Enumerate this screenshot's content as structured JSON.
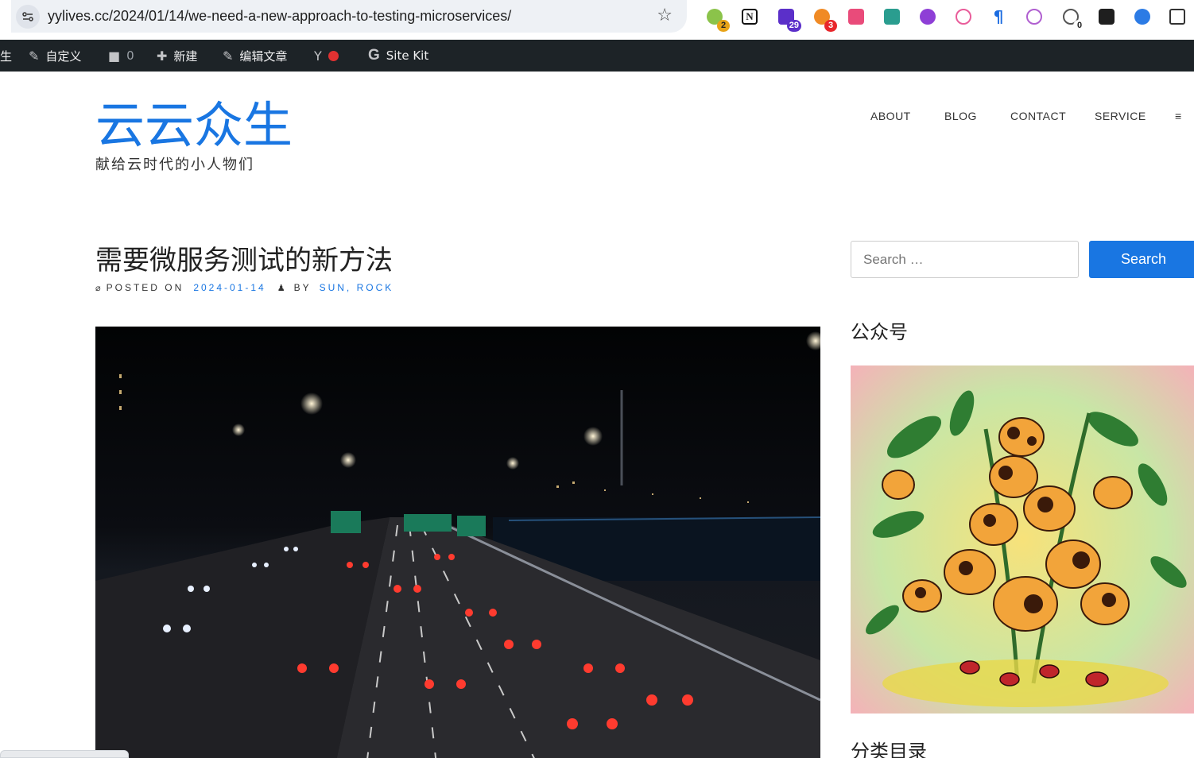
{
  "browser": {
    "url": "yylives.cc/2024/01/14/we-need-a-new-approach-to-testing-microservices/",
    "extensions": [
      {
        "icon": "gemini-extension-icon",
        "badge": "2",
        "badge_color": "#e8a317"
      },
      {
        "icon": "notion-icon",
        "badge": ""
      },
      {
        "icon": "graduation-cap-icon",
        "badge": "29",
        "badge_color": "#5b2fc9"
      },
      {
        "icon": "circles-icon",
        "badge": "3",
        "badge_color": "#e8262b"
      },
      {
        "icon": "translate-icon",
        "badge": ""
      },
      {
        "icon": "grid-icon",
        "badge": ""
      },
      {
        "icon": "lr-icon",
        "badge": ""
      },
      {
        "icon": "cloud-icon",
        "badge": ""
      },
      {
        "icon": "pilcrow-icon",
        "badge": ""
      },
      {
        "icon": "openai-icon",
        "badge": ""
      },
      {
        "icon": "refresh-counter-icon",
        "badge": "0",
        "badge_color": "#ffffff"
      },
      {
        "icon": "dark-square-icon",
        "badge": ""
      },
      {
        "icon": "blue-circle-icon",
        "badge": ""
      },
      {
        "icon": "puzzle-icon",
        "badge": ""
      }
    ]
  },
  "admin_bar": {
    "cut_item": "生",
    "customize": "自定义",
    "comments_count": "0",
    "new": "新建",
    "edit_post": "编辑文章",
    "site_kit": "Site Kit"
  },
  "site": {
    "title": "云云众生",
    "description": "献给云时代的小人物们"
  },
  "nav": {
    "items": [
      "ABOUT",
      "BLOG",
      "CONTACT",
      "SERVICE"
    ],
    "menu_glyph": "≡"
  },
  "post": {
    "title": "需要微服务测试的新方法",
    "posted_on_label": "POSTED ON",
    "date": "2024-01-14",
    "by_label": "BY",
    "author": "SUN, ROCK"
  },
  "sidebar": {
    "search_placeholder": "Search …",
    "search_button": "Search",
    "widget_wechat": "公众号",
    "widget_categories": "分类目录"
  },
  "colors": {
    "accent": "#1976e2",
    "admin_bar": "#1d2327"
  }
}
